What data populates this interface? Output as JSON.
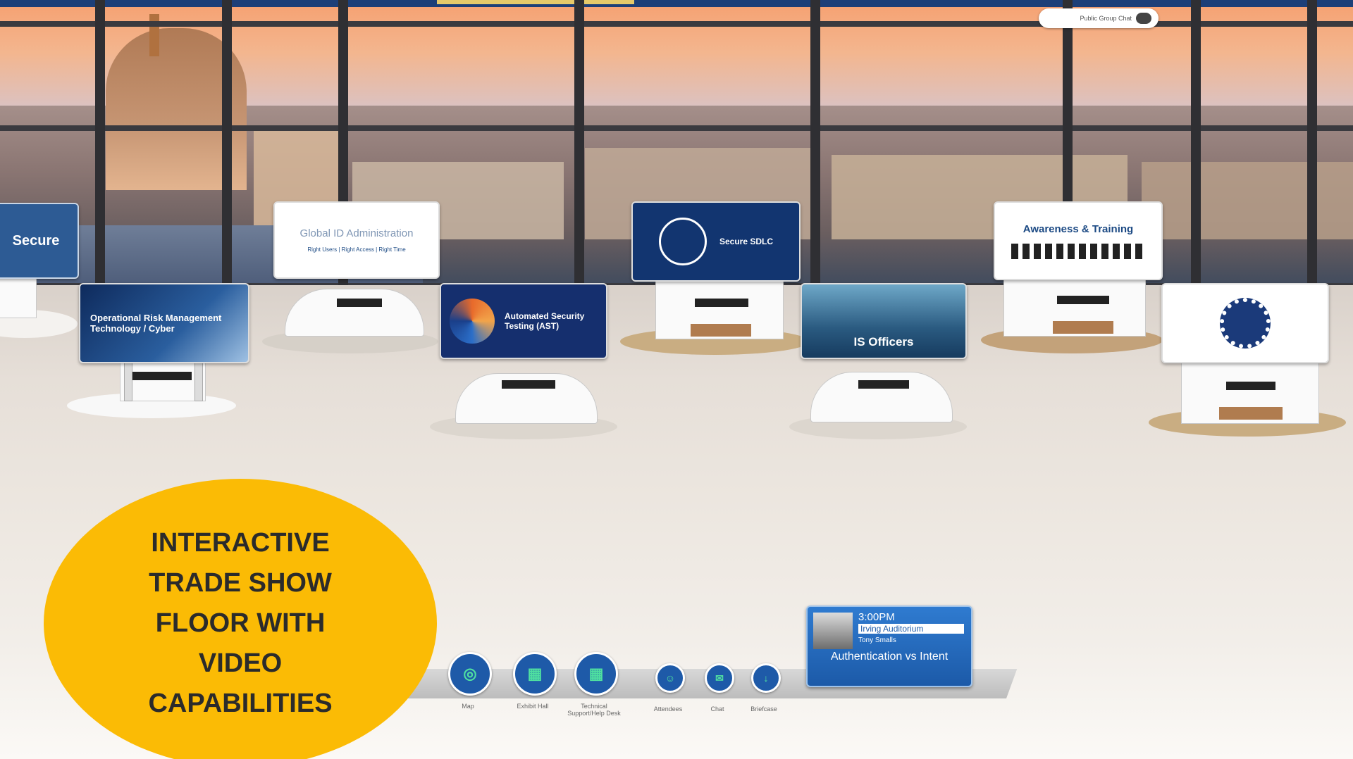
{
  "top_right": {
    "chat_label": "Public Group Chat",
    "chat_icon": "chat-bubbles-icon"
  },
  "booths": [
    {
      "sign": "Secure",
      "theme": "#1a4f8f"
    },
    {
      "sign": "Operational Risk Management Technology / Cyber",
      "theme": "#12367a"
    },
    {
      "sign": "Global ID Administration",
      "sub": "Right Users | Right Access | Right Time",
      "theme": "#ffffff"
    },
    {
      "sign": "Automated Security Testing (AST)",
      "theme": "#12367a"
    },
    {
      "sign": "Secure SDLC",
      "theme": "#12367a"
    },
    {
      "sign": "IS Officers",
      "theme": "#1f4c7a"
    },
    {
      "sign": "Awareness & Training",
      "theme": "#ffffff"
    },
    {
      "sign": "",
      "theme": "#ffffff"
    }
  ],
  "toolbar": {
    "items": [
      {
        "label": "Map",
        "icon": "map-pin-icon"
      },
      {
        "label": "Exhibit Hall",
        "icon": "grid-icon"
      },
      {
        "label": "Technical Support/Help Desk",
        "icon": "help-grid-icon"
      },
      {
        "label": "Attendees",
        "icon": "person-icon"
      },
      {
        "label": "Chat",
        "icon": "chat-icon"
      },
      {
        "label": "Briefcase",
        "icon": "download-icon"
      }
    ]
  },
  "session": {
    "time": "3:00PM",
    "room": "Irving Auditorium",
    "speaker": "Tony Smalls",
    "title": "Authentication vs Intent"
  },
  "callout": {
    "lines": [
      "INTERACTIVE",
      "TRADE SHOW",
      "FLOOR WITH",
      "VIDEO",
      "CAPABILITIES"
    ],
    "color": "#fbbb05"
  }
}
